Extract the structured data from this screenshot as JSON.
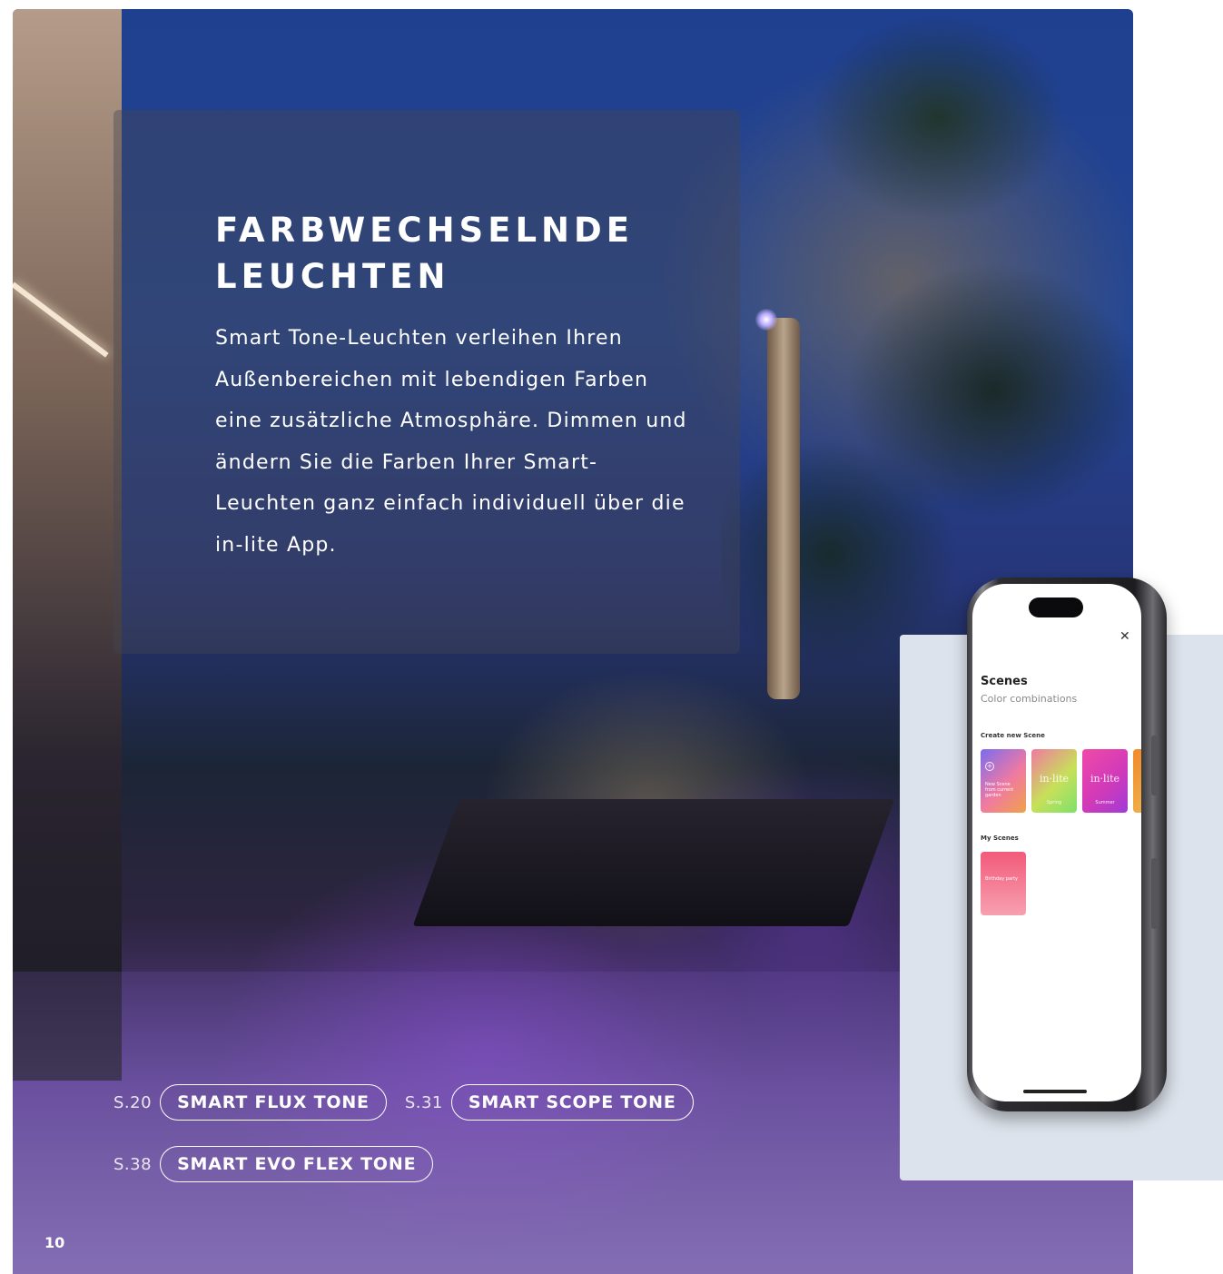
{
  "headline": "FARBWECHSELNDE LEUCHTEN",
  "body": "Smart Tone-Leuchten verleihen Ihren Außenbereichen mit lebendigen Farben eine zusätzliche Atmosphäre. Dimmen und ändern Sie die Farben Ihrer Smart-Leuchten ganz einfach individuell über die in-lite App.",
  "products": [
    {
      "page": "S.20",
      "name": "SMART FLUX TONE"
    },
    {
      "page": "S.31",
      "name": "SMART SCOPE TONE"
    },
    {
      "page": "S.38",
      "name": "SMART EVO FLEX TONE"
    }
  ],
  "page_number": "10",
  "app_screen": {
    "close_icon": "close-icon",
    "title": "Scenes",
    "subtitle": "Color combinations",
    "create_section": "Create new Scene",
    "cards": [
      {
        "brand": "",
        "label": "New Scene from current garden",
        "color_from": "#7b6cf0",
        "color_to": "#f0a24a"
      },
      {
        "brand": "in·lite",
        "label": "Spring",
        "color_from": "#f07aa0",
        "color_to": "#7ee06a"
      },
      {
        "brand": "in·lite",
        "label": "Summer",
        "color_from": "#f04aa8",
        "color_to": "#a13ad6"
      }
    ],
    "my_section": "My Scenes",
    "my_cards": [
      {
        "label": "Birthday party",
        "color_from": "#f25a7a",
        "color_to": "#f7a0b0"
      }
    ]
  },
  "colors": {
    "panel": "rgba(70,70,80,0.42)",
    "text": "#ffffff",
    "phone_bg": "#dde3ec"
  }
}
